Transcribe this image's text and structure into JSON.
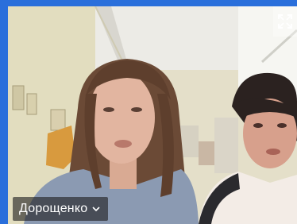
{
  "video_tile": {
    "participant_name": "Дорощенко",
    "name_menu_icon": "chevron-down-icon",
    "expand_icon": "fullscreen-expand-icon"
  },
  "colors": {
    "frame_border": "#2a6fdb",
    "name_tag_bg": "rgba(30,30,30,0.62)",
    "name_tag_text": "#ffffff"
  }
}
